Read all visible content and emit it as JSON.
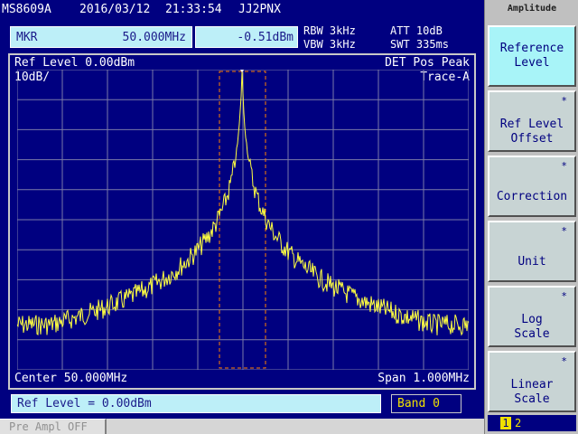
{
  "header": {
    "model": "MS8609A",
    "date": "2016/03/12",
    "time": "21:33:54",
    "callsign": "JJ2PNX"
  },
  "marker": {
    "label": "MKR",
    "frequency": "50.000MHz",
    "level": "-0.51dBm"
  },
  "params": {
    "rbw": "RBW 3kHz",
    "vbw": "VBW 3kHz",
    "att": "ATT 10dB",
    "swt": "SWT 335ms"
  },
  "plot": {
    "ref_level": "Ref Level  0.00dBm",
    "scale": "10dB/",
    "detector": "DET  Pos Peak",
    "trace": "Trace-A",
    "center": "Center 50.000MHz",
    "span": "Span 1.000MHz"
  },
  "status": {
    "input_text": "Ref Level = 0.00dBm",
    "band": "Band 0",
    "preamp": "Pre Ampl OFF"
  },
  "softkeys": {
    "title": "Amplitude",
    "items": [
      {
        "label": "Reference\nLevel",
        "star": "",
        "active": true
      },
      {
        "label": "Ref Level\nOffset",
        "star": "*",
        "active": false
      },
      {
        "label": "Correction",
        "star": "*",
        "active": false
      },
      {
        "label": "Unit",
        "star": "*",
        "active": false
      },
      {
        "label": "Log\nScale",
        "star": "*",
        "active": false
      },
      {
        "label": "Linear\nScale",
        "star": "*",
        "active": false
      }
    ],
    "page_current": "1",
    "page_other": "2"
  },
  "colors": {
    "background": "#000080",
    "grid": "#8080a0",
    "trace": "#ffff40",
    "marker_band": "#ff8000",
    "highlight": "#bdeff8"
  }
}
